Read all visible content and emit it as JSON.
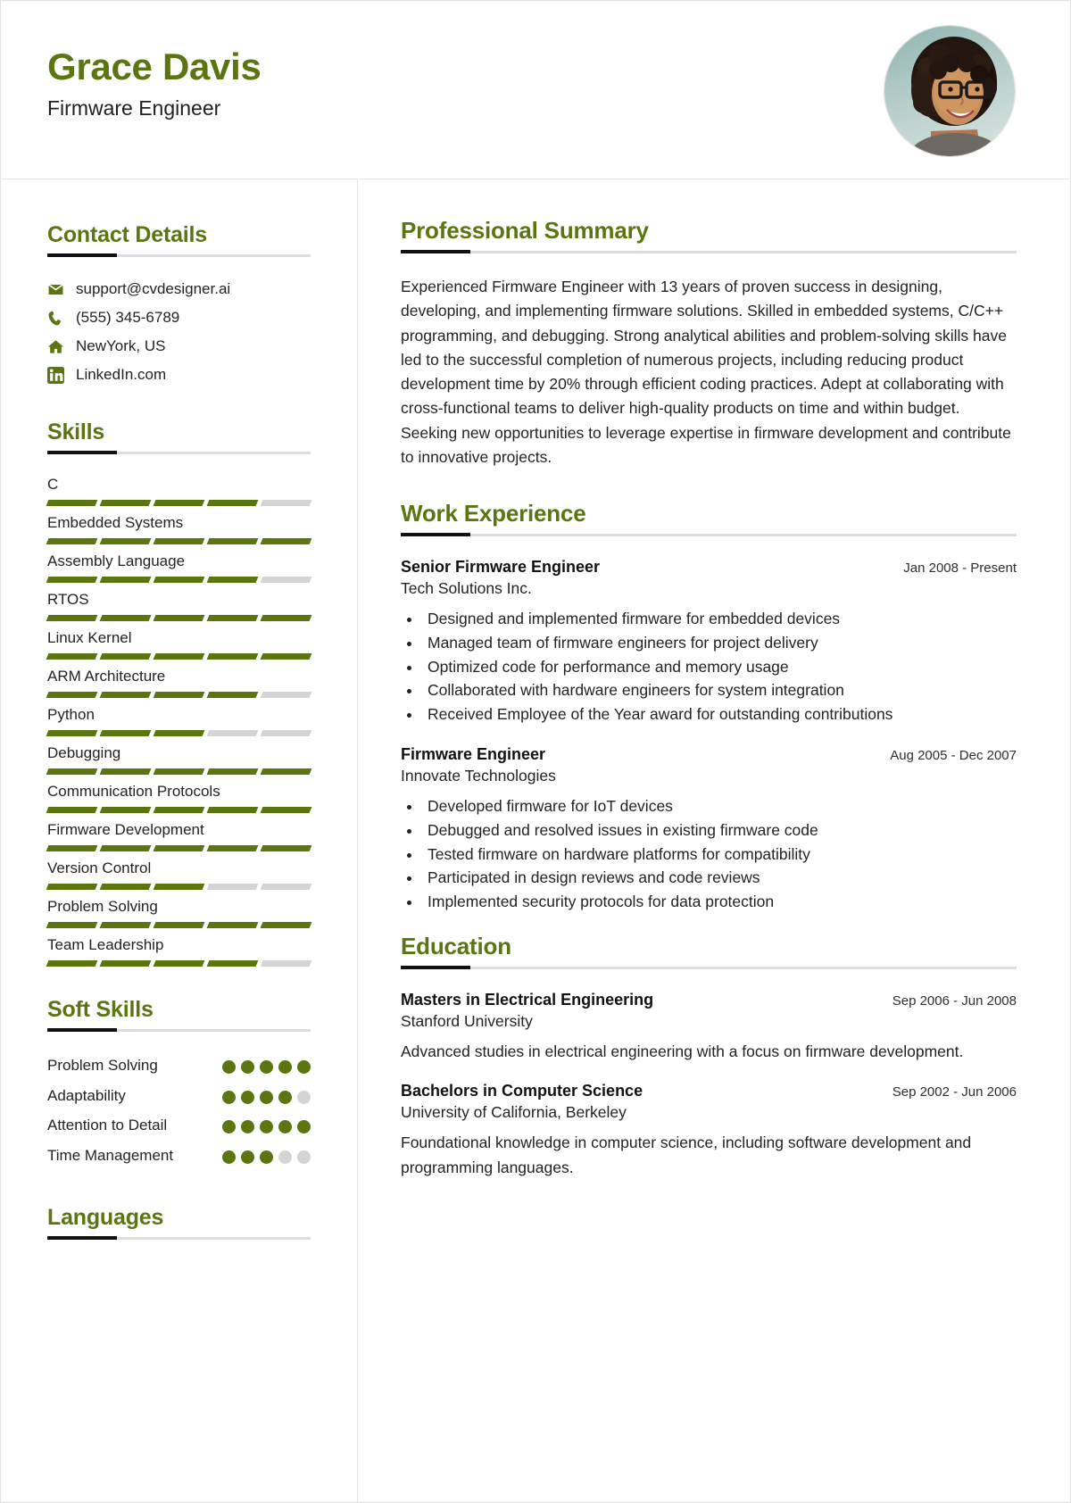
{
  "header": {
    "name": "Grace Davis",
    "role": "Firmware Engineer",
    "accent_color": "#5b7511",
    "avatar_alt": "profile-photo"
  },
  "sidebar": {
    "contact": {
      "heading": "Contact Details",
      "items": [
        {
          "icon": "email-icon",
          "value": "support@cvdesigner.ai"
        },
        {
          "icon": "phone-icon",
          "value": "(555) 345-6789"
        },
        {
          "icon": "home-icon",
          "value": "NewYork, US"
        },
        {
          "icon": "linkedin-icon",
          "value": "LinkedIn.com"
        }
      ]
    },
    "skills": {
      "heading": "Skills",
      "max_level": 5,
      "items": [
        {
          "name": "C",
          "level": 4
        },
        {
          "name": "Embedded Systems",
          "level": 5
        },
        {
          "name": "Assembly Language",
          "level": 4
        },
        {
          "name": "RTOS",
          "level": 5
        },
        {
          "name": "Linux Kernel",
          "level": 5
        },
        {
          "name": "ARM Architecture",
          "level": 4
        },
        {
          "name": "Python",
          "level": 3
        },
        {
          "name": "Debugging",
          "level": 5
        },
        {
          "name": "Communication Protocols",
          "level": 5
        },
        {
          "name": "Firmware Development",
          "level": 5
        },
        {
          "name": "Version Control",
          "level": 3
        },
        {
          "name": "Problem Solving",
          "level": 5
        },
        {
          "name": "Team Leadership",
          "level": 4
        }
      ]
    },
    "soft_skills": {
      "heading": "Soft Skills",
      "max_level": 5,
      "items": [
        {
          "name": "Problem Solving",
          "level": 5
        },
        {
          "name": "Adaptability",
          "level": 4
        },
        {
          "name": "Attention to Detail",
          "level": 5
        },
        {
          "name": "Time Management",
          "level": 3
        }
      ]
    },
    "languages": {
      "heading": "Languages"
    }
  },
  "main": {
    "summary": {
      "heading": "Professional Summary",
      "text": "Experienced Firmware Engineer with 13 years of proven success in designing, developing, and implementing firmware solutions. Skilled in embedded systems, C/C++ programming, and debugging. Strong analytical abilities and problem-solving skills have led to the successful completion of numerous projects, including reducing product development time by 20% through efficient coding practices. Adept at collaborating with cross-functional teams to deliver high-quality products on time and within budget. Seeking new opportunities to leverage expertise in firmware development and contribute to innovative projects."
    },
    "work": {
      "heading": "Work Experience",
      "entries": [
        {
          "title": "Senior Firmware Engineer",
          "date": "Jan 2008 - Present",
          "org": "Tech Solutions Inc.",
          "bullets": [
            "Designed and implemented firmware for embedded devices",
            "Managed team of firmware engineers for project delivery",
            "Optimized code for performance and memory usage",
            "Collaborated with hardware engineers for system integration",
            "Received Employee of the Year award for outstanding contributions"
          ]
        },
        {
          "title": "Firmware Engineer",
          "date": "Aug 2005 - Dec 2007",
          "org": "Innovate Technologies",
          "bullets": [
            "Developed firmware for IoT devices",
            "Debugged and resolved issues in existing firmware code",
            "Tested firmware on hardware platforms for compatibility",
            "Participated in design reviews and code reviews",
            "Implemented security protocols for data protection"
          ]
        }
      ]
    },
    "education": {
      "heading": "Education",
      "entries": [
        {
          "degree": "Masters in Electrical Engineering",
          "date": "Sep 2006 - Jun 2008",
          "school": "Stanford University",
          "description": "Advanced studies in electrical engineering with a focus on firmware development."
        },
        {
          "degree": "Bachelors in Computer Science",
          "date": "Sep 2002 - Jun 2006",
          "school": "University of California, Berkeley",
          "description": "Foundational knowledge in computer science, including software development and programming languages."
        }
      ]
    }
  }
}
